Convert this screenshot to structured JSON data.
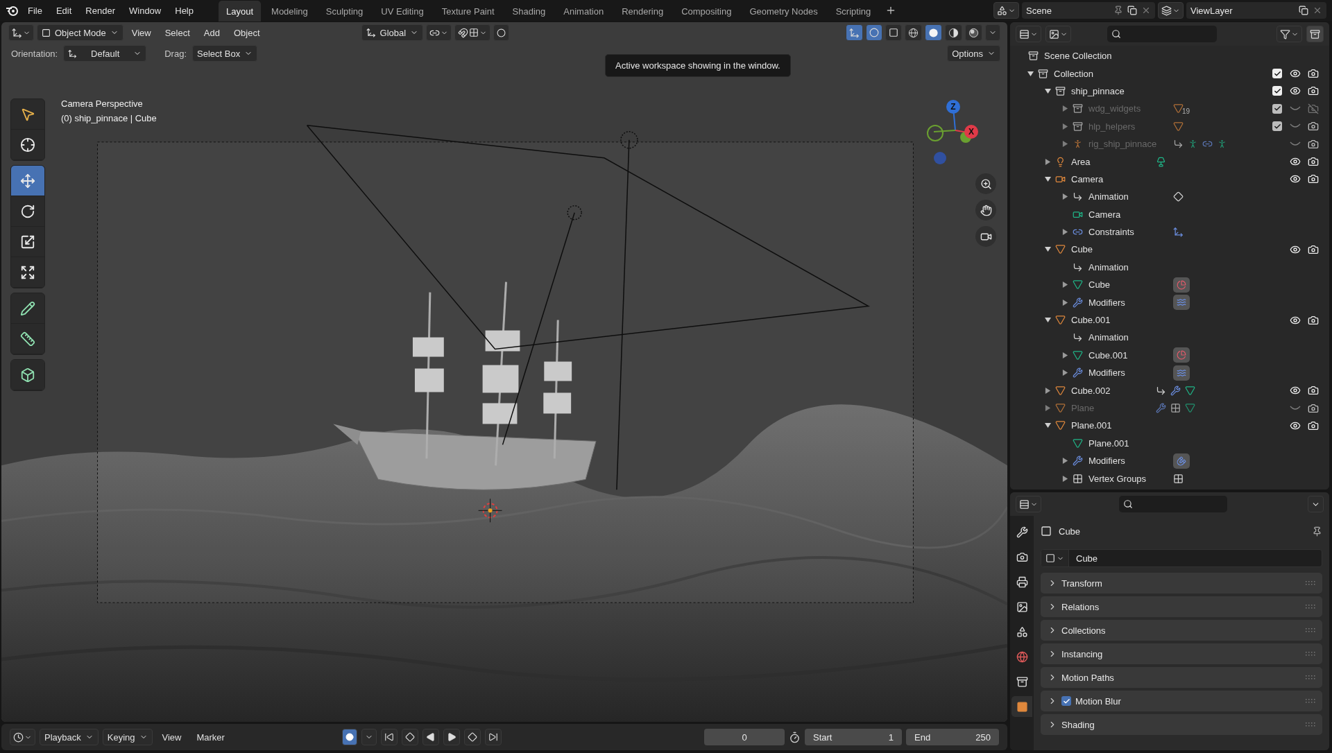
{
  "menu": [
    "File",
    "Edit",
    "Render",
    "Window",
    "Help"
  ],
  "workspaces": [
    {
      "label": "Layout",
      "selected": true
    },
    {
      "label": "Modeling",
      "selected": false
    },
    {
      "label": "Sculpting",
      "selected": false
    },
    {
      "label": "UV Editing",
      "selected": false
    },
    {
      "label": "Texture Paint",
      "selected": false
    },
    {
      "label": "Shading",
      "selected": false
    },
    {
      "label": "Animation",
      "selected": false
    },
    {
      "label": "Rendering",
      "selected": false
    },
    {
      "label": "Compositing",
      "selected": false
    },
    {
      "label": "Geometry Nodes",
      "selected": false
    },
    {
      "label": "Scripting",
      "selected": false
    }
  ],
  "scene": {
    "name": "Scene"
  },
  "view_layer": {
    "name": "ViewLayer"
  },
  "viewport": {
    "mode": "Object Mode",
    "menus": [
      "View",
      "Select",
      "Add",
      "Object"
    ],
    "transform_orientation": "Global",
    "tooltip": "Active workspace showing in the window.",
    "orientation_label": "Orientation:",
    "orientation_value": "Default",
    "drag_label": "Drag:",
    "drag_value": "Select Box",
    "options": "Options",
    "overlay_title": "Camera Perspective",
    "overlay_subtitle": "(0) ship_pinnace | Cube",
    "tools": [
      {
        "kind": "select",
        "selected": false
      },
      {
        "kind": "cursor",
        "selected": false
      },
      {
        "kind": "move",
        "selected": true
      },
      {
        "kind": "rotate",
        "selected": false
      },
      {
        "kind": "scale",
        "selected": false
      },
      {
        "kind": "transform",
        "selected": false
      },
      {
        "kind": "annotate",
        "selected": false
      },
      {
        "kind": "measure",
        "selected": false
      },
      {
        "kind": "add_cube",
        "selected": false
      }
    ],
    "shading_modes": [
      {
        "kind": "wireframe",
        "selected": false
      },
      {
        "kind": "solid",
        "selected": true
      },
      {
        "kind": "material",
        "selected": false
      },
      {
        "kind": "rendered",
        "selected": false
      }
    ],
    "gizmo_axes": [
      {
        "label": "Z",
        "color": "#2f6fd6"
      },
      {
        "label": "X",
        "color": "#e03a48"
      }
    ]
  },
  "outliner": {
    "root": "Scene Collection",
    "items": [
      {
        "label": "Collection",
        "kind": "collection",
        "expanded": true,
        "dimmed": false,
        "checked": true,
        "visible": true,
        "renderable": true,
        "children": [
          {
            "label": "ship_pinnace",
            "kind": "collection",
            "expanded": true,
            "dimmed": false,
            "checked": true,
            "visible": true,
            "renderable": true,
            "children": [
              {
                "label": "wdg_widgets",
                "kind": "collection",
                "expanded": false,
                "dimmed": true,
                "checked": true,
                "visible": false,
                "renderable": false,
                "tags": [
                  {
                    "kind": "mesh_object"
                  }
                ],
                "count": "19"
              },
              {
                "label": "hlp_helpers",
                "kind": "collection",
                "expanded": false,
                "dimmed": true,
                "checked": true,
                "visible": false,
                "renderable": true,
                "tags": [
                  {
                    "kind": "mesh_object"
                  }
                ]
              },
              {
                "label": "rig_ship_pinnace",
                "kind": "armature",
                "expanded": false,
                "dimmed": true,
                "visible": false,
                "renderable": true,
                "tags": [
                  {
                    "kind": "animation"
                  },
                  {
                    "kind": "armature_pose"
                  },
                  {
                    "kind": "constraint"
                  },
                  {
                    "kind": "armature_pose"
                  }
                ]
              }
            ]
          },
          {
            "label": "Area",
            "kind": "light",
            "expanded": false,
            "dimmed": false,
            "visible": true,
            "renderable": true,
            "tags": [
              {
                "kind": "light_data"
              }
            ]
          },
          {
            "label": "Camera",
            "kind": "camera",
            "expanded": true,
            "dimmed": false,
            "visible": true,
            "renderable": true,
            "children": [
              {
                "label": "Animation",
                "kind": "animation",
                "expanded": false,
                "dimmed": false,
                "tags": [
                  {
                    "kind": "keyframes"
                  }
                ]
              },
              {
                "label": "Camera",
                "kind": "camera_data",
                "dimmed": false
              },
              {
                "label": "Constraints",
                "kind": "constraint",
                "expanded": false,
                "dimmed": false,
                "tags": [
                  {
                    "kind": "constraint_axes"
                  }
                ]
              }
            ]
          },
          {
            "label": "Cube",
            "kind": "mesh_object",
            "expanded": true,
            "dimmed": false,
            "visible": true,
            "renderable": true,
            "children": [
              {
                "label": "Animation",
                "kind": "animation",
                "dimmed": false
              },
              {
                "label": "Cube",
                "kind": "mesh",
                "expanded": false,
                "dimmed": false,
                "tags": [
                  {
                    "kind": "material"
                  }
                ]
              },
              {
                "label": "Modifiers",
                "kind": "modifier",
                "expanded": false,
                "dimmed": false,
                "tags": [
                  {
                    "kind": "ocean"
                  }
                ]
              }
            ]
          },
          {
            "label": "Cube.001",
            "kind": "mesh_object",
            "expanded": true,
            "dimmed": false,
            "visible": true,
            "renderable": true,
            "children": [
              {
                "label": "Animation",
                "kind": "animation",
                "dimmed": false
              },
              {
                "label": "Cube.001",
                "kind": "mesh",
                "expanded": false,
                "dimmed": false,
                "tags": [
                  {
                    "kind": "material"
                  }
                ]
              },
              {
                "label": "Modifiers",
                "kind": "modifier",
                "expanded": false,
                "dimmed": false,
                "tags": [
                  {
                    "kind": "ocean"
                  }
                ]
              }
            ]
          },
          {
            "label": "Cube.002",
            "kind": "mesh_object",
            "expanded": false,
            "dimmed": false,
            "visible": true,
            "renderable": true,
            "tags": [
              {
                "kind": "animation"
              },
              {
                "kind": "modifier"
              },
              {
                "kind": "mesh"
              }
            ]
          },
          {
            "label": "Plane",
            "kind": "mesh_object",
            "expanded": false,
            "dimmed": true,
            "visible": false,
            "renderable": true,
            "tags": [
              {
                "kind": "modifier"
              },
              {
                "kind": "vertex_groups"
              },
              {
                "kind": "mesh"
              }
            ]
          },
          {
            "label": "Plane.001",
            "kind": "mesh_object",
            "expanded": true,
            "dimmed": false,
            "visible": true,
            "renderable": true,
            "children": [
              {
                "label": "Plane.001",
                "kind": "mesh",
                "dimmed": false
              },
              {
                "label": "Modifiers",
                "kind": "modifier",
                "expanded": false,
                "dimmed": false,
                "tags": [
                  {
                    "kind": "arch"
                  }
                ]
              },
              {
                "label": "Vertex Groups",
                "kind": "vertex_groups",
                "expanded": false,
                "dimmed": false,
                "tags": [
                  {
                    "kind": "vertex_groups"
                  }
                ]
              }
            ]
          }
        ]
      }
    ]
  },
  "properties": {
    "tabs": [
      {
        "kind": "tool",
        "selected": false
      },
      {
        "kind": "render",
        "selected": false
      },
      {
        "kind": "output",
        "selected": false
      },
      {
        "kind": "view_layer",
        "selected": false
      },
      {
        "kind": "scene",
        "selected": false
      },
      {
        "kind": "world",
        "selected": false
      },
      {
        "kind": "collection",
        "selected": false
      },
      {
        "kind": "object",
        "selected": true
      }
    ],
    "object_name": "Cube",
    "name_field": "Cube",
    "panels": [
      {
        "label": "Transform"
      },
      {
        "label": "Relations"
      },
      {
        "label": "Collections"
      },
      {
        "label": "Instancing"
      },
      {
        "label": "Motion Paths"
      },
      {
        "label": "Motion Blur",
        "checked": true
      },
      {
        "label": "Shading"
      }
    ]
  },
  "timeline": {
    "menus": [
      {
        "label": "Playback",
        "dropdown": true
      },
      {
        "label": "Keying",
        "dropdown": true
      },
      {
        "label": "View",
        "dropdown": false
      },
      {
        "label": "Marker",
        "dropdown": false
      }
    ],
    "current_frame": "0",
    "start_label": "Start",
    "start": "1",
    "end_label": "End",
    "end": "250"
  }
}
